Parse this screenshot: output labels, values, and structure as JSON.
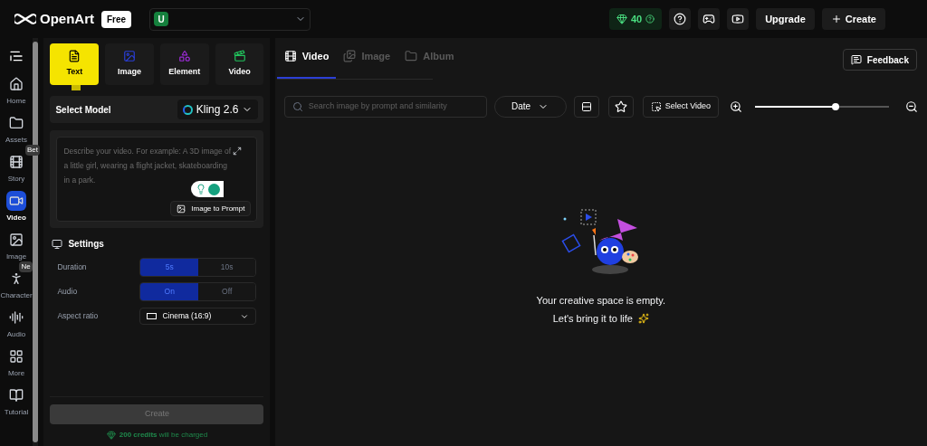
{
  "topbar": {
    "logo": "OpenArt",
    "plan_badge": "Free",
    "workspace": {
      "avatar": "U"
    },
    "credits": "40",
    "buttons": [
      {
        "label": "Upgrade",
        "kind": "plain"
      },
      {
        "label": "Create",
        "kind": "plus"
      }
    ]
  },
  "sidebar": {
    "items": [
      {
        "label": "Home",
        "kind": "home",
        "selected": false
      },
      {
        "label": "Assets",
        "kind": "folder",
        "selected": false
      },
      {
        "label": "Story",
        "kind": "film",
        "selected": false,
        "badge": "Bet"
      },
      {
        "label": "Video",
        "kind": "video",
        "selected": true
      },
      {
        "label": "Image",
        "kind": "image",
        "selected": false
      },
      {
        "label": "Character",
        "kind": "person",
        "selected": false,
        "badge": "Ne"
      },
      {
        "label": "Audio",
        "kind": "audio",
        "selected": false
      },
      {
        "label": "More",
        "kind": "more",
        "selected": false
      },
      {
        "label": "Tutorial",
        "kind": "book",
        "selected": false
      }
    ]
  },
  "mode_tabs": [
    {
      "label": "Text",
      "kind": "text",
      "selected": true
    },
    {
      "label": "Image",
      "kind": "image",
      "selected": false
    },
    {
      "label": "Element",
      "kind": "element",
      "selected": false
    },
    {
      "label": "Video",
      "kind": "video",
      "selected": false
    }
  ],
  "model": {
    "label": "Select Model",
    "value": "Kling 2.6"
  },
  "prompt": {
    "placeholder": "Describe your video. For example: A 3D image of a little girl, wearing a flight jacket, skateboarding in a park.",
    "button": "Image to Prompt"
  },
  "settings": {
    "title": "Settings",
    "rows": [
      {
        "kind": "toggle",
        "label": "Duration",
        "options": [
          {
            "label": "5s",
            "selected": true
          },
          {
            "label": "10s",
            "selected": false
          }
        ]
      },
      {
        "kind": "toggle",
        "label": "Audio",
        "options": [
          {
            "label": "On",
            "selected": true
          },
          {
            "label": "Off",
            "selected": false
          }
        ]
      },
      {
        "kind": "select",
        "label": "Aspect ratio",
        "value": "Cinema (16:9)"
      }
    ]
  },
  "create": {
    "label": "Create",
    "disabled": true,
    "note": "**200 credits** will be charged"
  },
  "content_tabs": [
    {
      "label": "Video",
      "kind": "video",
      "selected": true
    },
    {
      "label": "Image",
      "kind": "image",
      "selected": false
    },
    {
      "label": "Album",
      "kind": "folder",
      "selected": false
    }
  ],
  "feedback": "Feedback",
  "toolbar": {
    "search_placeholder": "Search image by prompt and similarity",
    "sort": "Date",
    "select": "Select Video",
    "zoom": {
      "level": 0.6
    }
  },
  "empty": {
    "title": "Your creative space is empty.",
    "subtitle": "Let's bring it to life"
  }
}
